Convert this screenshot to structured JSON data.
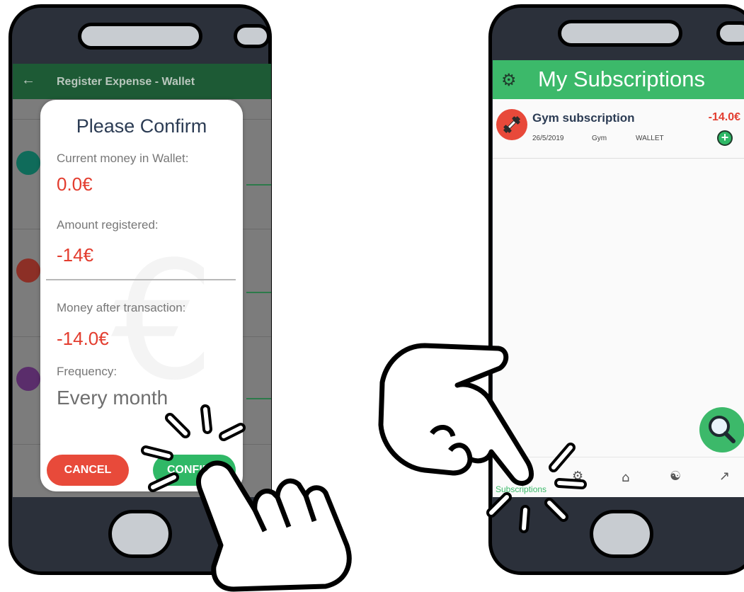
{
  "left_screen": {
    "appbar": {
      "back_icon": "arrow-left-icon",
      "title": "Register Expense - Wallet"
    },
    "dialog": {
      "title": "Please Confirm",
      "current_label": "Current money in Wallet:",
      "current_value": "0.0€",
      "amount_label": "Amount registered:",
      "amount_value": "-14€",
      "after_label": "Money after transaction:",
      "after_value": "-14.0€",
      "frequency_label": "Frequency:",
      "frequency_value": "Every month",
      "cancel_label": "CANCEL",
      "confirm_label": "CONFIRM"
    }
  },
  "right_screen": {
    "appbar": {
      "settings_icon": "gear-icon",
      "title": "My Subscriptions"
    },
    "subscription": {
      "name": "Gym subscription",
      "amount": "-14.0€",
      "date": "26/5/2019",
      "category": "Gym",
      "source": "WALLET"
    },
    "bottom_nav": {
      "subscriptions_label": "Subscriptions"
    }
  },
  "colors": {
    "phone_body": "#2b303a",
    "app_green": "#3cb96a",
    "danger_red": "#e84a3a",
    "title_navy": "#2c3c54"
  }
}
